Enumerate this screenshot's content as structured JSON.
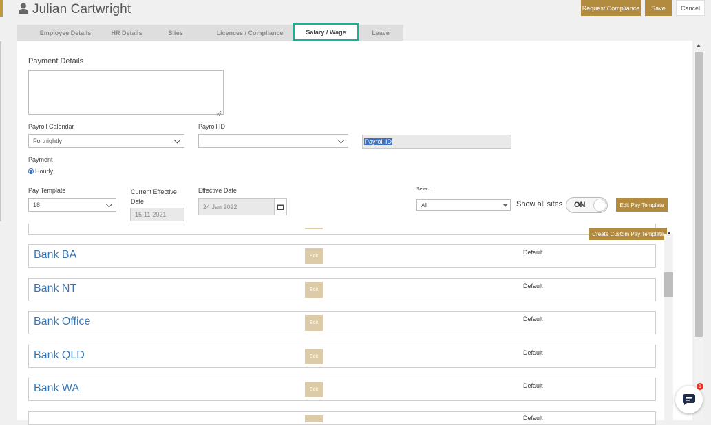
{
  "header": {
    "user_name": "Julian Cartwright",
    "request_compliance_label": "Request Compliance",
    "save_label": "Save",
    "cancel_label": "Cancel"
  },
  "tabs": [
    {
      "label": "Employee Details"
    },
    {
      "label": "HR Details"
    },
    {
      "label": "Sites"
    },
    {
      "label": "Licences / Compliance"
    },
    {
      "label": "Salary / Wage",
      "active": true
    },
    {
      "label": "Leave"
    }
  ],
  "form": {
    "payment_details_label": "Payment Details",
    "payment_details_value": "",
    "payroll_calendar_label": "Payroll Calendar",
    "payroll_calendar_value": "Fortnightly",
    "payroll_id_label": "Payroll ID",
    "payroll_id_value": "",
    "payroll_id_text": "Payroll ID",
    "payment_label": "Payment",
    "payment_option": "Hourly",
    "pay_template_label": "Pay Template",
    "pay_template_value": "18",
    "current_effective_label_1": "Current Effective",
    "current_effective_label_2": "Date",
    "current_effective_value": "15-11-2021",
    "effective_date_label": "Effective Date",
    "effective_date_value": "24 Jan 2022",
    "select_label": "Select :",
    "select_value": "All",
    "show_all_sites_label": "Show all sites",
    "toggle_state": "ON",
    "edit_pay_template_label": "Edit Pay Template",
    "create_custom_label": "Create Custom Pay Template"
  },
  "rows": [
    {
      "name": "Bank BA",
      "edit": "Edit",
      "status": "Default"
    },
    {
      "name": "Bank NT",
      "edit": "Edit",
      "status": "Default"
    },
    {
      "name": "Bank Office",
      "edit": "Edit",
      "status": "Default"
    },
    {
      "name": "Bank QLD",
      "edit": "Edit",
      "status": "Default"
    },
    {
      "name": "Bank WA",
      "edit": "Edit",
      "status": "Default"
    },
    {
      "name": "",
      "edit": "",
      "status": "Default"
    }
  ],
  "chat": {
    "badge": "1"
  },
  "colors": {
    "accent": "#b38b3e",
    "tab_highlight": "#15b39a",
    "link": "#3a78b5"
  }
}
